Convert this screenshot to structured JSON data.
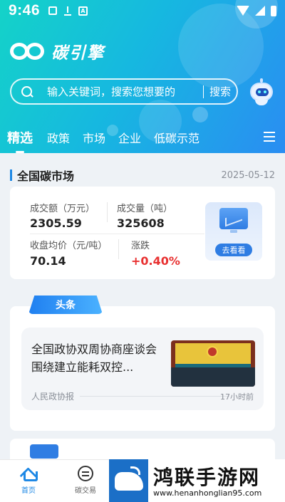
{
  "status_bar": {
    "time": "9:46",
    "left_icons": [
      "image-icon",
      "download-icon",
      "a-icon"
    ],
    "right_icons": [
      "wifi-icon",
      "signal-icon",
      "battery-icon"
    ]
  },
  "header": {
    "logo_text": "碳引擎",
    "search": {
      "placeholder": "输入关键词，搜索您想要的",
      "button_label": "搜索"
    },
    "assistant_icon": "robot-icon"
  },
  "tabs": [
    {
      "label": "精选",
      "active": true
    },
    {
      "label": "政策",
      "active": false
    },
    {
      "label": "市场",
      "active": false
    },
    {
      "label": "企业",
      "active": false
    },
    {
      "label": "低碳示范",
      "active": false
    }
  ],
  "market": {
    "title": "全国碳市场",
    "date": "2025-05-12",
    "stats": {
      "turnover_label": "成交额（万元）",
      "turnover_value": "2305.59",
      "volume_label": "成交量（吨）",
      "volume_value": "325608",
      "close_label": "收盘均价（元/吨）",
      "close_value": "70.14",
      "change_label": "涨跌",
      "change_value": "+0.40%"
    },
    "view_button": "去看看"
  },
  "news": {
    "tag": "头条",
    "items": [
      {
        "title": "全国政协双周协商座谈会围绕建立能耗双控...",
        "source": "人民政协报",
        "time": "17小时前"
      }
    ]
  },
  "bottom_nav": [
    {
      "label": "首页",
      "icon": "home-icon",
      "active": true
    },
    {
      "label": "碳交易",
      "icon": "exchange-icon",
      "active": false
    }
  ],
  "watermark": {
    "title": "鸿联手游网",
    "url": "www.henanhonglian95.com"
  },
  "colors": {
    "accent": "#1e88e5",
    "positive": "#e83030",
    "hero_start": "#14d3c8",
    "hero_end": "#2a8df2"
  }
}
